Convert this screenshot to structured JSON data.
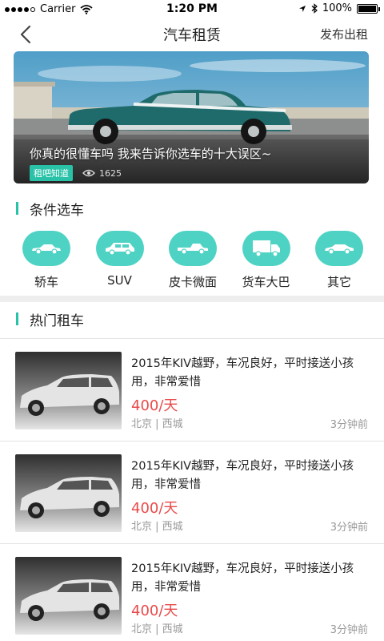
{
  "status": {
    "carrier": "Carrier",
    "time": "1:20 PM",
    "battery": "100%"
  },
  "nav": {
    "title": "汽车租赁",
    "publish_label": "发布出租"
  },
  "banner": {
    "caption": "你真的很懂车吗 我来告诉你选车的十大误区~",
    "tag": "租吧知道",
    "views": "1625"
  },
  "sections": {
    "filter_title": "条件选车",
    "hot_title": "热门租车"
  },
  "categories": [
    {
      "label": "轿车",
      "icon": "sedan-icon"
    },
    {
      "label": "SUV",
      "icon": "suv-icon"
    },
    {
      "label": "皮卡微面",
      "icon": "pickup-icon"
    },
    {
      "label": "货车大巴",
      "icon": "truck-icon"
    },
    {
      "label": "其它",
      "icon": "other-car-icon"
    }
  ],
  "listings": [
    {
      "title": "2015年KIV越野，车况良好，平时接送小孩用，非常爱惜",
      "price": "400/天",
      "location": "北京 | 西城",
      "time": "3分钟前"
    },
    {
      "title": "2015年KIV越野，车况良好，平时接送小孩用，非常爱惜",
      "price": "400/天",
      "location": "北京 | 西城",
      "time": "3分钟前"
    },
    {
      "title": "2015年KIV越野，车况良好，平时接送小孩用，非常爱惜",
      "price": "400/天",
      "location": "北京 | 西城",
      "time": "3分钟前"
    }
  ],
  "colors": {
    "accent": "#29c2a9",
    "category_bg": "#4dd2c4",
    "price": "#e94a4a"
  }
}
